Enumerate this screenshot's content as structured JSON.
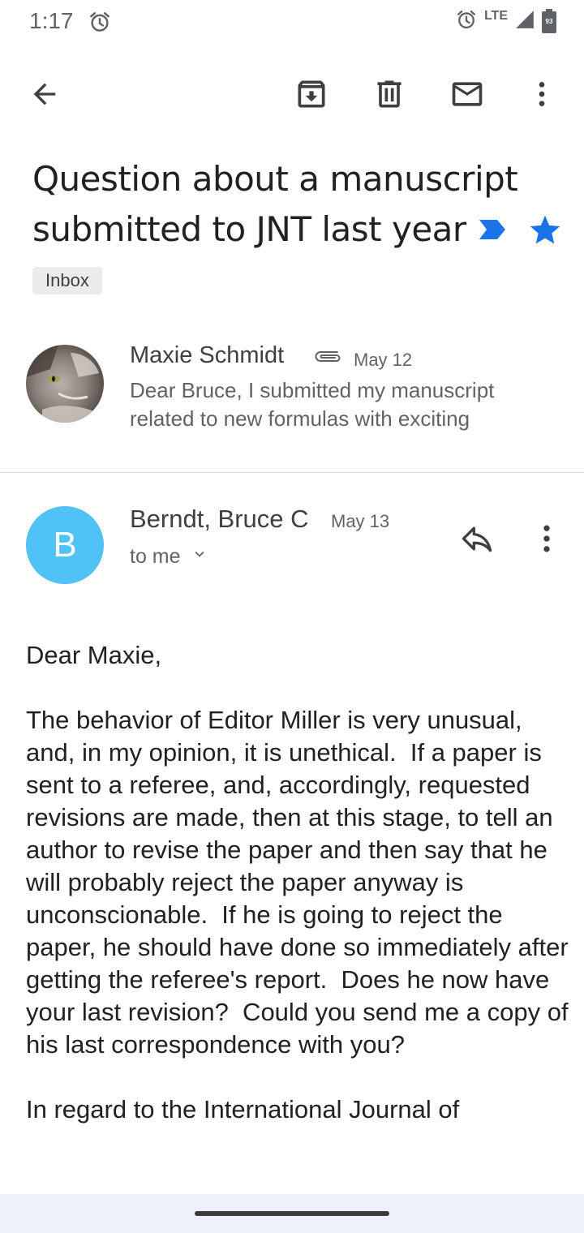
{
  "status_bar": {
    "time": "1:17",
    "network": "LTE",
    "battery": "93"
  },
  "toolbar": {
    "icons": [
      "back-arrow-icon",
      "archive-icon",
      "delete-icon",
      "mark-unread-icon",
      "more-vert-icon"
    ]
  },
  "email": {
    "subject": "Question about a manuscript submitted to JNT last year",
    "label": "Inbox",
    "starred": true,
    "accent_color": "#1a73e8"
  },
  "thread": {
    "collapsed_message": {
      "sender": "Maxie Schmidt",
      "date": "May 12",
      "snippet": "Dear Bruce, I submitted my manuscript related to new formulas with exciting"
    },
    "expanded_message": {
      "avatar_letter": "B",
      "avatar_color": "#4fc3f7",
      "sender": "Berndt, Bruce C",
      "date": "May 13",
      "recipient": "to me",
      "body": "Dear Maxie,\n\nThe behavior of Editor Miller is very unusual, and, in my opinion, it is unethical.  If a paper is sent to a referee, and, accordingly, requested revisions are made, then at this stage, to tell an author to revise the paper and then say that he will probably reject the paper anyway is unconscionable.  If he is going to reject the paper, he should have done so immediately after getting the referee's report.  Does he now have your last revision?  Could you send me a copy of his last correspondence with you?\n\nIn regard to the International Journal of"
    }
  }
}
